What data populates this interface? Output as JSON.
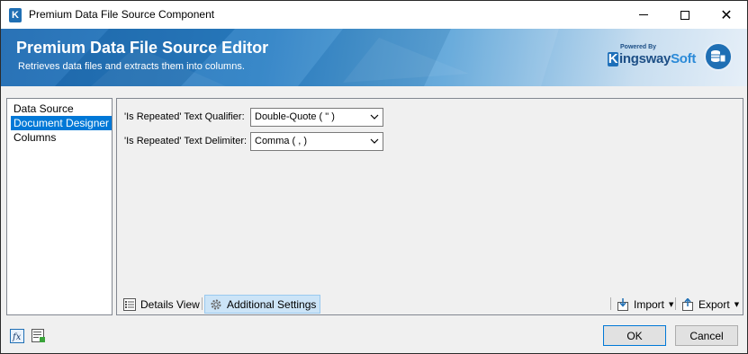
{
  "window": {
    "title": "Premium Data File Source Component",
    "app_icon_letter": "K"
  },
  "banner": {
    "title": "Premium Data File Source Editor",
    "subtitle": "Retrieves data files and extracts them into columns.",
    "brand_powered": "Powered By",
    "brand_k": "K",
    "brand_ingsway": "ingsway",
    "brand_soft": "Soft"
  },
  "nav": {
    "items": [
      {
        "label": "Data Source",
        "selected": false
      },
      {
        "label": "Document Designer",
        "selected": true
      },
      {
        "label": "Columns",
        "selected": false
      }
    ]
  },
  "settings": {
    "qualifier_label": "'Is Repeated' Text Qualifier:",
    "qualifier_value": "Double-Quote ( \" )",
    "delimiter_label": "'Is Repeated' Text Delimiter:",
    "delimiter_value": "Comma ( , )"
  },
  "toolbar": {
    "details_view": "Details View",
    "additional_settings": "Additional Settings",
    "import": "Import",
    "export": "Export"
  },
  "footer": {
    "ok": "OK",
    "cancel": "Cancel"
  },
  "colors": {
    "accent": "#0078d7",
    "banner_blue": "#1e6bb3",
    "brand": "#1d4f86"
  }
}
